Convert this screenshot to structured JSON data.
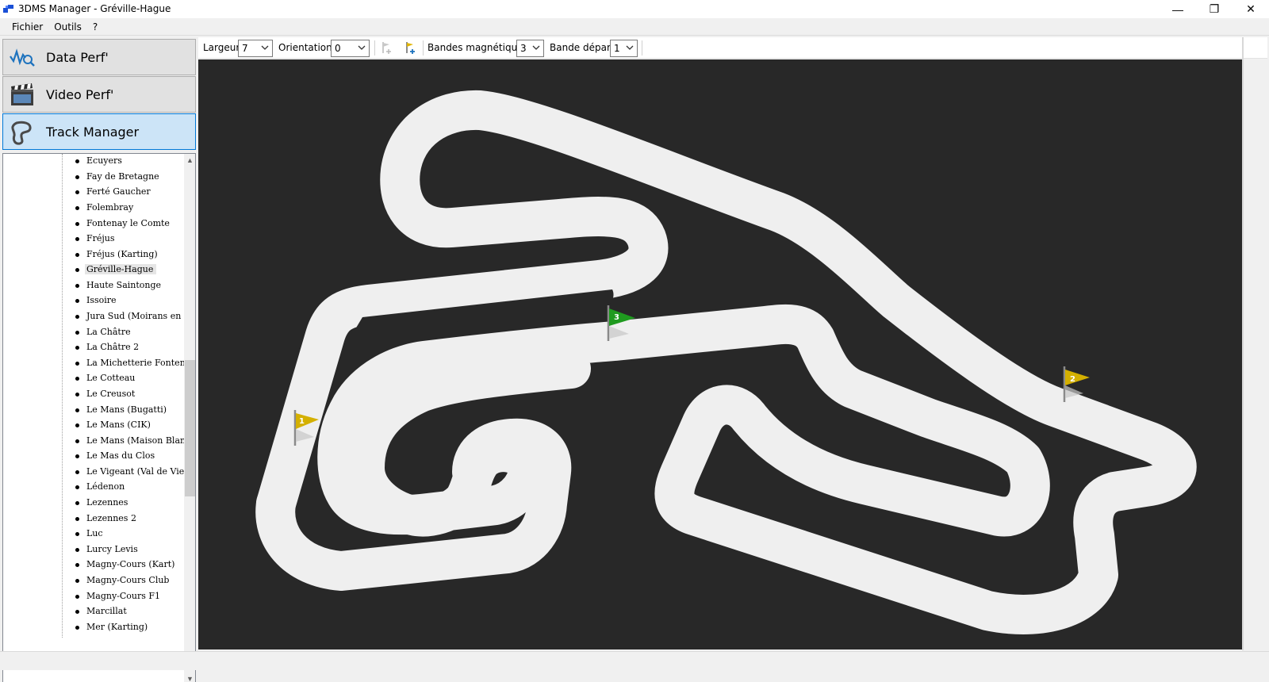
{
  "window": {
    "title": "3DMS Manager - Gréville-Hague",
    "minimize_glyph": "—",
    "maximize_glyph": "❐",
    "close_glyph": "✕"
  },
  "menu": [
    "Fichier",
    "Outils",
    "?"
  ],
  "nav": [
    {
      "label": "Data Perf'",
      "icon": "waveform-search-icon",
      "active": false
    },
    {
      "label": "Video Perf'",
      "icon": "clapperboard-icon",
      "active": false
    },
    {
      "label": "Track Manager",
      "icon": "track-outline-icon",
      "active": true
    }
  ],
  "tracks": {
    "items": [
      "Ecuyers",
      "Fay de Bretagne",
      "Ferté Gaucher",
      "Folembray",
      "Fontenay le Comte",
      "Fréjus",
      "Fréjus (Karting)",
      "Gréville-Hague",
      "Haute Saintonge",
      "Issoire",
      "Jura Sud (Moirans en Mont",
      "La Châtre",
      "La Châtre 2",
      "La Michetterie Fontenay",
      "Le Cotteau",
      "Le Creusot",
      "Le Mans (Bugatti)",
      "Le Mans (CIK)",
      "Le Mans (Maison Blanche)",
      "Le Mas du Clos",
      "Le Vigeant (Val de Vienne)",
      "Lédenon",
      "Lezennes",
      "Lezennes 2",
      "Luc",
      "Lurcy Levis",
      "Magny-Cours (Kart)",
      "Magny-Cours Club",
      "Magny-Cours F1",
      "Marcillat",
      "Mer (Karting)"
    ],
    "selected": "Gréville-Hague"
  },
  "scroll": {
    "up": "▲",
    "down": "▼",
    "left": "◀",
    "right": "▶"
  },
  "toolbar": {
    "largeur_label": "Largeur",
    "largeur_value": "7",
    "orientation_label": "Orientation",
    "orientation_value": "0",
    "add_flag_disabled_icon": "flag-add-disabled-icon",
    "add_flag_icon": "flag-add-icon",
    "bandes_label": "Bandes magnétiques",
    "bandes_value": "3",
    "depart_label": "Bande départ",
    "depart_value": "1"
  },
  "flags": [
    {
      "number": "1",
      "color": "#d4b000"
    },
    {
      "number": "2",
      "color": "#d4b000"
    },
    {
      "number": "3",
      "color": "#1f9a1f"
    }
  ],
  "colors": {
    "canvas": "#282828",
    "track": "#efefef",
    "nav_active": "#cce4f7",
    "accent": "#0078d7"
  }
}
